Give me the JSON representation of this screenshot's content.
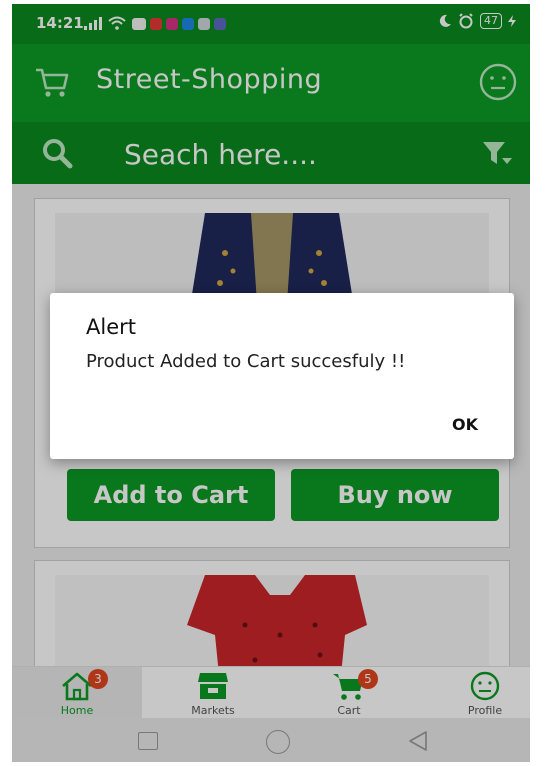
{
  "status_bar": {
    "time": "14:21",
    "battery": "47"
  },
  "app_bar": {
    "title": "Street-Shopping"
  },
  "search": {
    "placeholder": "Seach here...."
  },
  "products": [
    {
      "add_label": "Add to Cart",
      "buy_label": "Buy now"
    }
  ],
  "dialog": {
    "title": "Alert",
    "message": "Product Added to Cart succesfuly !!",
    "ok_label": "OK"
  },
  "bottom_nav": {
    "tabs": [
      {
        "label": "Home",
        "badge": "3"
      },
      {
        "label": "Markets"
      },
      {
        "label": "Cart",
        "badge": "5"
      },
      {
        "label": "Profile"
      }
    ]
  },
  "colors": {
    "brand_green": "#0e9a24",
    "badge": "#e2461f"
  },
  "icons": [
    "cart-icon",
    "smiley-icon",
    "search-icon",
    "filter-icon",
    "home-icon",
    "store-icon"
  ]
}
